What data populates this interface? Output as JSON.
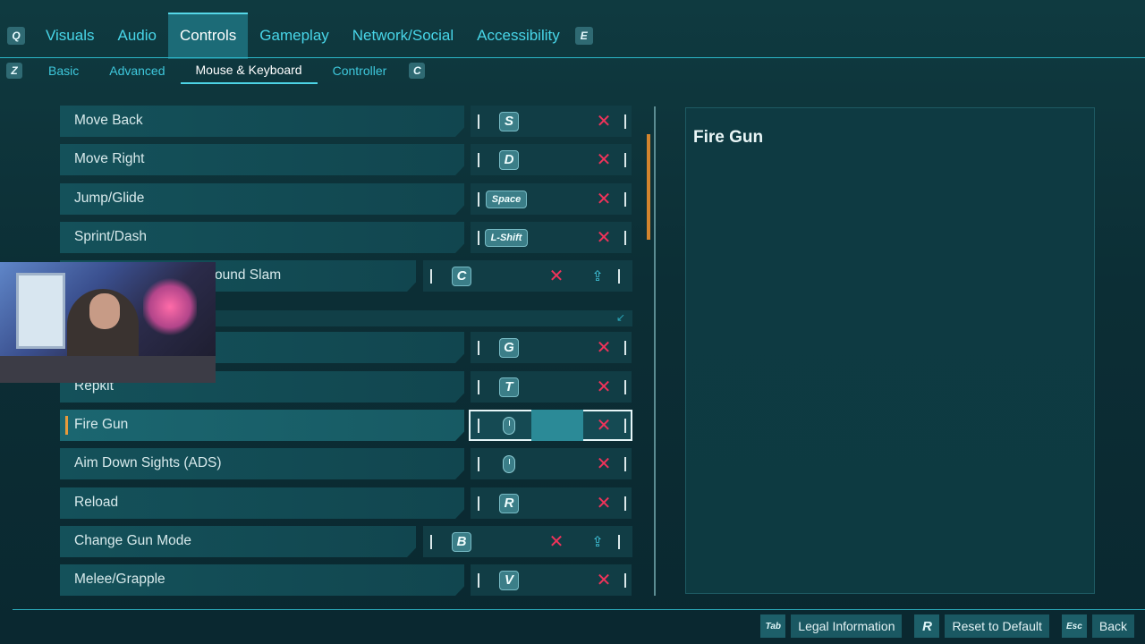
{
  "top_tabs": {
    "left_key": "Q",
    "right_key": "E",
    "items": [
      "Visuals",
      "Audio",
      "Controls",
      "Gameplay",
      "Network/Social",
      "Accessibility"
    ],
    "active": "Controls"
  },
  "sub_tabs": {
    "left_key": "Z",
    "right_key": "C",
    "items": [
      "Basic",
      "Advanced",
      "Mouse & Keyboard",
      "Controller"
    ],
    "active": "Mouse & Keyboard"
  },
  "bindings": [
    {
      "label": "Move Back",
      "key": "S"
    },
    {
      "label": "Move Right",
      "key": "D"
    },
    {
      "label": "Jump/Glide",
      "key": "Space"
    },
    {
      "label": "Sprint/Dash",
      "key": "L-Shift"
    },
    {
      "label": "ound Slam",
      "key": "C"
    },
    {
      "label": "",
      "key": "G"
    },
    {
      "label": "Repkit",
      "key": "T"
    },
    {
      "label": "Fire Gun",
      "key": "left-mouse-button"
    },
    {
      "label": "Aim Down Sights (ADS)",
      "key": "right-mouse-button"
    },
    {
      "label": "Reload",
      "key": "R"
    },
    {
      "label": "Change Gun Mode",
      "key": "B"
    },
    {
      "label": "Melee/Grapple",
      "key": "V"
    }
  ],
  "selected_binding": "Fire Gun",
  "detail": {
    "title": "Fire Gun"
  },
  "bottom_bar": [
    {
      "key": "Tab",
      "label": "Legal Information"
    },
    {
      "key": "R",
      "label": "Reset to Default"
    },
    {
      "key": "Esc",
      "label": "Back"
    }
  ],
  "colors": {
    "accent": "#48d6e9",
    "unbind": "#f0335a",
    "selected_marker": "#e79a3b"
  }
}
